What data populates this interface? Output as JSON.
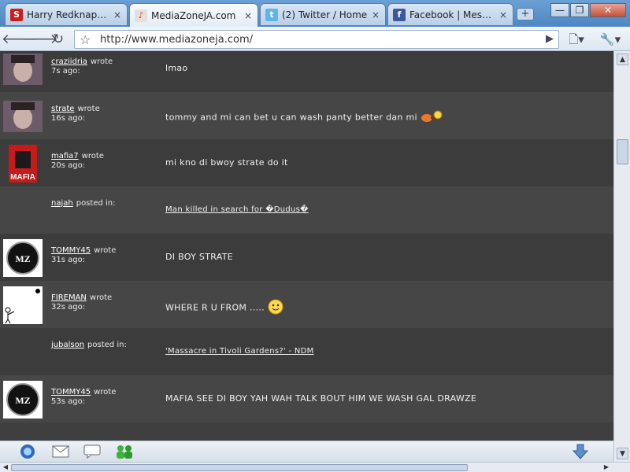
{
  "browser": {
    "tabs": [
      {
        "title": "Harry Redknapp has...",
        "favicon": "sky-sports-favicon-icon",
        "active": false
      },
      {
        "title": "MediaZoneJA.com",
        "favicon": "mediazone-favicon-icon",
        "active": true
      },
      {
        "title": "(2) Twitter / Home",
        "favicon": "twitter-bird-icon",
        "active": false
      },
      {
        "title": "Facebook | Message...",
        "favicon": "facebook-favicon-icon",
        "active": false
      }
    ],
    "new_tab_label": "+",
    "close_glyph": "×",
    "url": "http://www.mediazoneja.com/",
    "window_controls": {
      "minimize": "—",
      "maximize": "❐",
      "close": "✕"
    }
  },
  "feed": {
    "items": [
      {
        "user": "craziidria",
        "action": "wrote",
        "time": "7s ago:",
        "message": "lmao",
        "avatar": "photo-avatar",
        "is_link": false
      },
      {
        "user": "strate",
        "action": "wrote",
        "time": "16s ago:",
        "message": "tommy and mi can bet u can wash panty better dan mi",
        "avatar": "photo-avatar",
        "is_link": false,
        "emote": "guitar-emoticon-icon"
      },
      {
        "user": "mafia7",
        "action": "wrote",
        "time": "20s ago:",
        "message": "mi kno di bwoy strate do it",
        "avatar": "mafia-avatar",
        "avatar_text": "MAFIA",
        "is_link": false
      },
      {
        "user": "najah",
        "action": "posted in:",
        "time": "",
        "message": "Man killed in search for \u0000Dudus\u0000",
        "avatar": "none",
        "is_link": true
      },
      {
        "user": "TOMMY45",
        "action": "wrote",
        "time": "31s ago:",
        "message": "DI BOY STRATE",
        "avatar": "mz-alliance-avatar",
        "avatar_text": "MZ",
        "is_link": false
      },
      {
        "user": "FIREMAN",
        "action": "wrote",
        "time": "32s ago:",
        "message": "WHERE R U FROM .....",
        "avatar": "stickman-avatar",
        "is_link": false,
        "emote": "smiley-emoticon-icon"
      },
      {
        "user": "jubalson",
        "action": "posted in:",
        "time": "",
        "message": "'Massacre in Tivoli Gardens?' - NDM",
        "avatar": "none",
        "is_link": true
      },
      {
        "user": "TOMMY45",
        "action": "wrote",
        "time": "53s ago:",
        "message": "MAFIA SEE DI BOY YAH WAH TALK BOUT HIM WE WASH GAL DRAWZE",
        "avatar": "mz-alliance-avatar",
        "avatar_text": "MZ",
        "is_link": false
      }
    ]
  },
  "bottombar": {
    "icons": [
      "chat-bubble-logo-icon",
      "mail-icon",
      "comment-icon",
      "friends-icon",
      "download-arrow-icon"
    ]
  },
  "colors": {
    "row_odd": "#464646",
    "row_even": "#3c3c3c",
    "text": "#f0f0f0",
    "tab_strip": "#5a92cb"
  }
}
